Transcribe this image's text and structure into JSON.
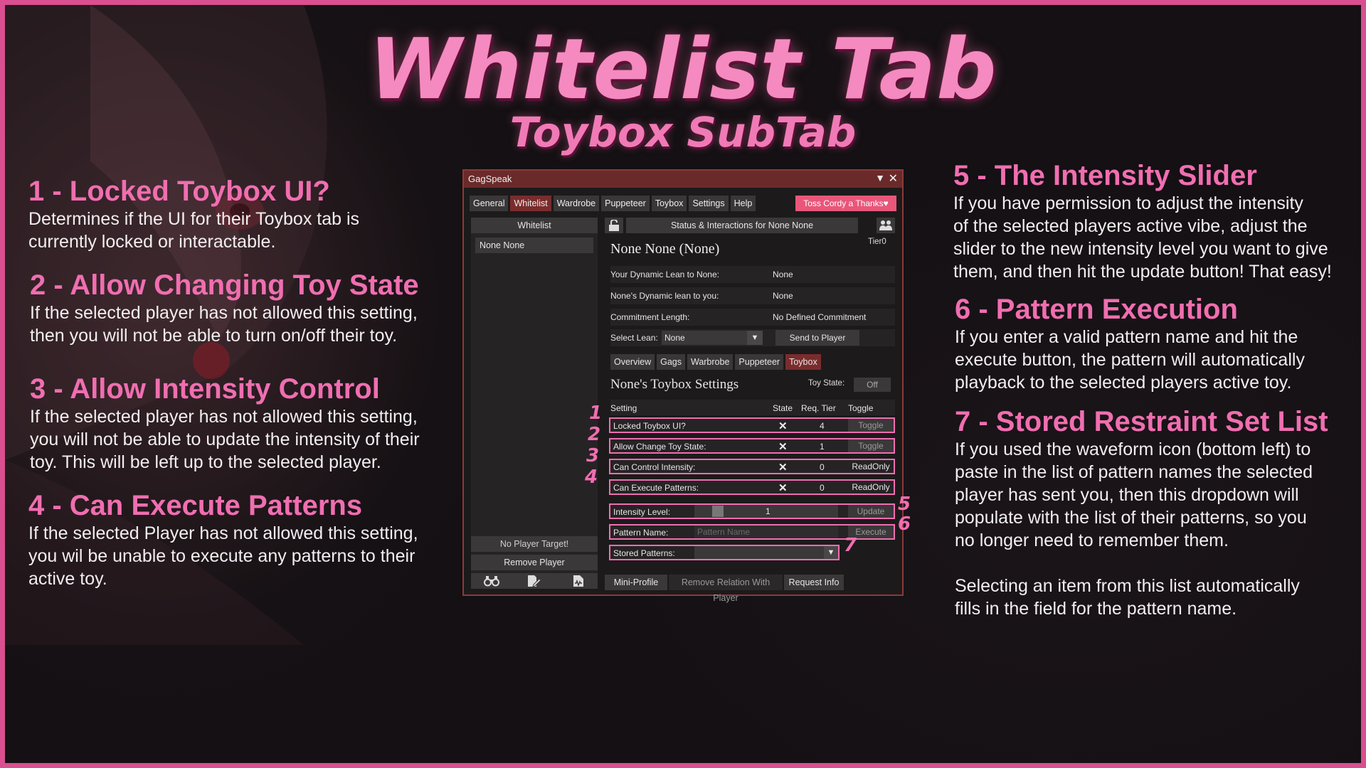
{
  "header": {
    "title": "Whitelist Tab",
    "subtitle": "Toybox SubTab"
  },
  "notes": [
    {
      "heading": "1 - Locked Toybox UI?",
      "body": "Determines if the UI for their Toybox tab is\ncurrently locked or interactable."
    },
    {
      "heading": "2 - Allow Changing Toy State",
      "body": "If the selected player has not allowed this setting,\nthen you will not be able to turn on/off their toy."
    },
    {
      "heading": "3 - Allow Intensity Control",
      "body": "If the selected player has not allowed this setting,\nyou will not be able to update the intensity of their\ntoy. This will be left up to the selected player."
    },
    {
      "heading": "4 - Can Execute Patterns",
      "body": "If the selected Player has not allowed this setting,\nyou wil be unable to execute any patterns to their\nactive toy."
    },
    {
      "heading": "5 - The Intensity Slider",
      "body": "If you have permission to adjust the intensity\nof the selected players active vibe, adjust the\nslider to the new intensity level you want to give\nthem, and then hit the update button! That easy!"
    },
    {
      "heading": "6 - Pattern Execution",
      "body": "If you enter a valid pattern name and hit the\nexecute button, the pattern will automatically\nplayback to the selected players active toy."
    },
    {
      "heading": "7 - Stored Restraint Set List",
      "body": "If you used the waveform icon (bottom left) to\npaste in the list of pattern names the selected\nplayer has sent you, then this dropdown will\npopulate with the list of their patterns, so you\nno longer need to remember them.\n\nSelecting an item from this list automatically\nfills in the field for the pattern name."
    }
  ],
  "window": {
    "title": "GagSpeak",
    "collapse_glyph": "▼",
    "close_glyph": "✕",
    "tabs": [
      "General",
      "Whitelist",
      "Wardrobe",
      "Puppeteer",
      "Toybox",
      "Settings",
      "Help"
    ],
    "thanks_label": "Toss Cordy a Thanks♥",
    "whitelist_header": "Whitelist",
    "selected_player_item": "None None",
    "no_target": "No Player Target!",
    "remove_player": "Remove Player",
    "status_header": "Status & Interactions for None None",
    "tier": "Tier0",
    "player_name": "None None (None)",
    "info_rows": [
      {
        "label": "Your Dynamic Lean to None:",
        "value": "None"
      },
      {
        "label": "None's Dynamic lean to you:",
        "value": "None"
      },
      {
        "label": "Commitment Length:",
        "value": "No Defined Commitment"
      }
    ],
    "select_lean_label": "Select Lean:",
    "select_lean_value": "None",
    "send_button": "Send to Player",
    "subtabs": [
      "Overview",
      "Gags",
      "Warbrobe",
      "Puppeteer",
      "Toybox"
    ],
    "toybox_title": "None's Toybox Settings",
    "toy_state_label": "Toy State:",
    "toy_state_value": "Off",
    "settings_headers": {
      "setting": "Setting",
      "state": "State",
      "tier": "Req. Tier",
      "toggle": "Toggle"
    },
    "permissions": [
      {
        "label": "Locked Toybox UI?",
        "state": "✕",
        "tier": "4",
        "toggle": "Toggle"
      },
      {
        "label": "Allow Change Toy State:",
        "state": "✕",
        "tier": "1",
        "toggle": "Toggle"
      },
      {
        "label": "Can Control Intensity:",
        "state": "✕",
        "tier": "0",
        "toggle": "ReadOnly"
      },
      {
        "label": "Can Execute Patterns:",
        "state": "✕",
        "tier": "0",
        "toggle": "ReadOnly"
      }
    ],
    "intensity_label": "Intensity Level:",
    "intensity_value": "1",
    "update_button": "Update",
    "pattern_label": "Pattern Name:",
    "pattern_placeholder": "Pattern Name",
    "execute_button": "Execute",
    "stored_label": "Stored Patterns:",
    "bottom_buttons": [
      "Mini-Profile",
      "Remove Relation With Player",
      "Request Info"
    ]
  },
  "callout_numbers": [
    "1",
    "2",
    "3",
    "4",
    "5",
    "6",
    "7"
  ],
  "colors": {
    "accent": "#f06eb0",
    "frame": "#d94f8f",
    "window_title": "#6b2a2a",
    "tab_active": "#7a2c2c",
    "thanks_button": "#e8577a"
  }
}
